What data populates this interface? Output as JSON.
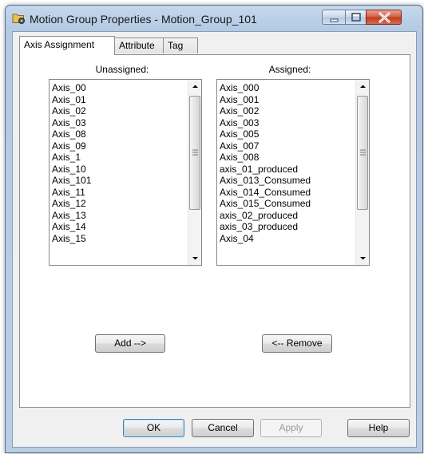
{
  "window": {
    "title": "Motion Group Properties - Motion_Group_101",
    "title_icon": "motion-group-icon",
    "controls": [
      "minimize",
      "maximize",
      "close"
    ]
  },
  "tabs": [
    {
      "label": "Axis Assignment",
      "active": true
    },
    {
      "label": "Attribute",
      "active": false
    },
    {
      "label": "Tag",
      "active": false
    }
  ],
  "unassigned": {
    "label": "Unassigned:",
    "items": [
      "Axis_00",
      "Axis_01",
      "Axis_02",
      "Axis_03",
      "Axis_08",
      "Axis_09",
      "Axis_1",
      "Axis_10",
      "Axis_101",
      "Axis_11",
      "Axis_12",
      "Axis_13",
      "Axis_14",
      "Axis_15"
    ]
  },
  "assigned": {
    "label": "Assigned:",
    "items": [
      "Axis_000",
      "Axis_001",
      "Axis_002",
      "Axis_003",
      "Axis_005",
      "Axis_007",
      "Axis_008",
      "axis_01_produced",
      "Axis_013_Consumed",
      "Axis_014_Consumed",
      "Axis_015_Consumed",
      "axis_02_produced",
      "axis_03_produced",
      "Axis_04"
    ]
  },
  "buttons": {
    "add": "Add -->",
    "remove": "<-- Remove",
    "ok": "OK",
    "cancel": "Cancel",
    "apply": "Apply",
    "help": "Help"
  },
  "colors": {
    "title_bar": "#b9cde6",
    "close_button": "#c13a1c",
    "dialog_bg": "#f0f0f0"
  }
}
